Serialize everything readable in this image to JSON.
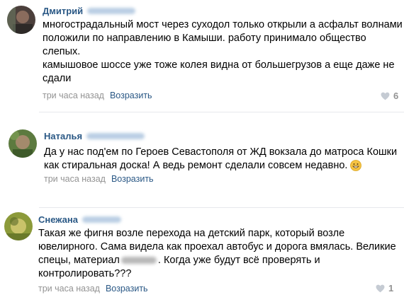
{
  "comments": [
    {
      "author": "Дмитрий",
      "lines": [
        "многострадальный мост через суходол только открыли а асфальт волнами",
        "положили по направлению в Камыши. работу принимало общество",
        "слепых.",
        "камышовое шоссе уже тоже колея видна от большегрузов а еще даже не",
        "сдали"
      ],
      "time": "три часа назад",
      "reply": "Возразить",
      "likes": "6"
    },
    {
      "author": "Наталья",
      "lines": [
        "Да у нас под'ем по Героев Севастополя от ЖД вокзала до матроса Кошки",
        "как стиральная доска! А ведь ремонт сделали совсем недавно."
      ],
      "time": "три часа назад",
      "reply": "Возразить",
      "likes": ""
    },
    {
      "author": "Снежана",
      "lines": [
        "Такая же фигня возле перехода на детский парк, который возле",
        "ювелирного. Сама видела как проехал автобус и дорога вмялась. Великие",
        "спецы, материал",
        ". Когда уже будут всё проверять и",
        "контролировать???"
      ],
      "time": "три часа назад",
      "reply": "Возразить",
      "likes": "1"
    }
  ],
  "colors": {
    "link": "#2a5885",
    "meta": "#939393",
    "divider": "#e7e8ec"
  },
  "icons": {
    "like": "heart-icon",
    "emoji": "grinning-face-emoji"
  }
}
